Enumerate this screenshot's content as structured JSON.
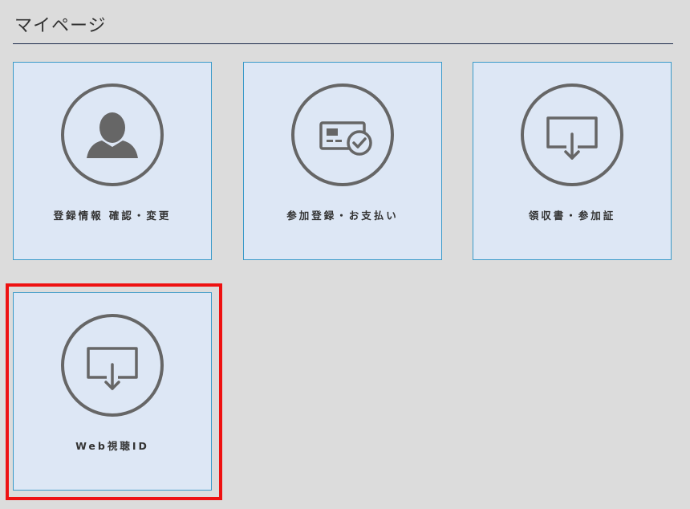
{
  "page": {
    "title": "マイページ"
  },
  "cards": [
    {
      "label": "登録情報 確認・変更",
      "icon": "user-profile-icon"
    },
    {
      "label": "参加登録・お支払い",
      "icon": "payment-card-check-icon"
    },
    {
      "label": "領収書・参加証",
      "icon": "download-icon"
    },
    {
      "label": "Web視聴ID",
      "icon": "download-icon"
    }
  ],
  "colors": {
    "background": "#dcdcdc",
    "card_background": "#dde7f5",
    "card_border": "#3a9ac9",
    "icon": "#666666",
    "highlight": "#ee1111"
  }
}
